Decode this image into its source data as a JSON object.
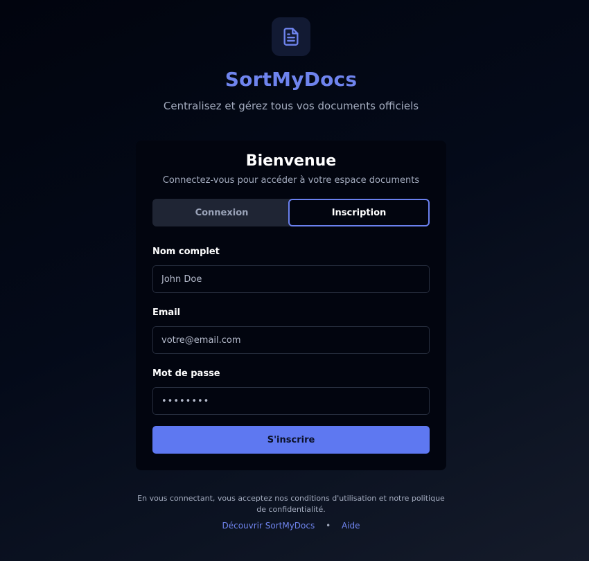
{
  "brand": {
    "name": "SortMyDocs",
    "tagline": "Centralisez et gérez tous vos documents officiels",
    "logo_icon": "document-icon",
    "accent_color": "#6f84ee"
  },
  "card": {
    "title": "Bienvenue",
    "subtitle": "Connectez-vous pour accéder à votre espace documents"
  },
  "tabs": {
    "login_label": "Connexion",
    "signup_label": "Inscription",
    "active": "Inscription"
  },
  "form": {
    "name": {
      "label": "Nom complet",
      "placeholder": "John Doe",
      "value": ""
    },
    "email": {
      "label": "Email",
      "placeholder": "votre@email.com",
      "value": ""
    },
    "password": {
      "label": "Mot de passe",
      "placeholder": "••••••••",
      "value": ""
    },
    "submit_label": "S'inscrire",
    "submit_color": "#5e78f1"
  },
  "footer": {
    "legal_text": "En vous connectant, vous acceptez nos conditions d'utilisation et notre politique de confidentialité.",
    "discover_label": "Découvrir SortMyDocs",
    "separator": "•",
    "help_label": "Aide"
  }
}
